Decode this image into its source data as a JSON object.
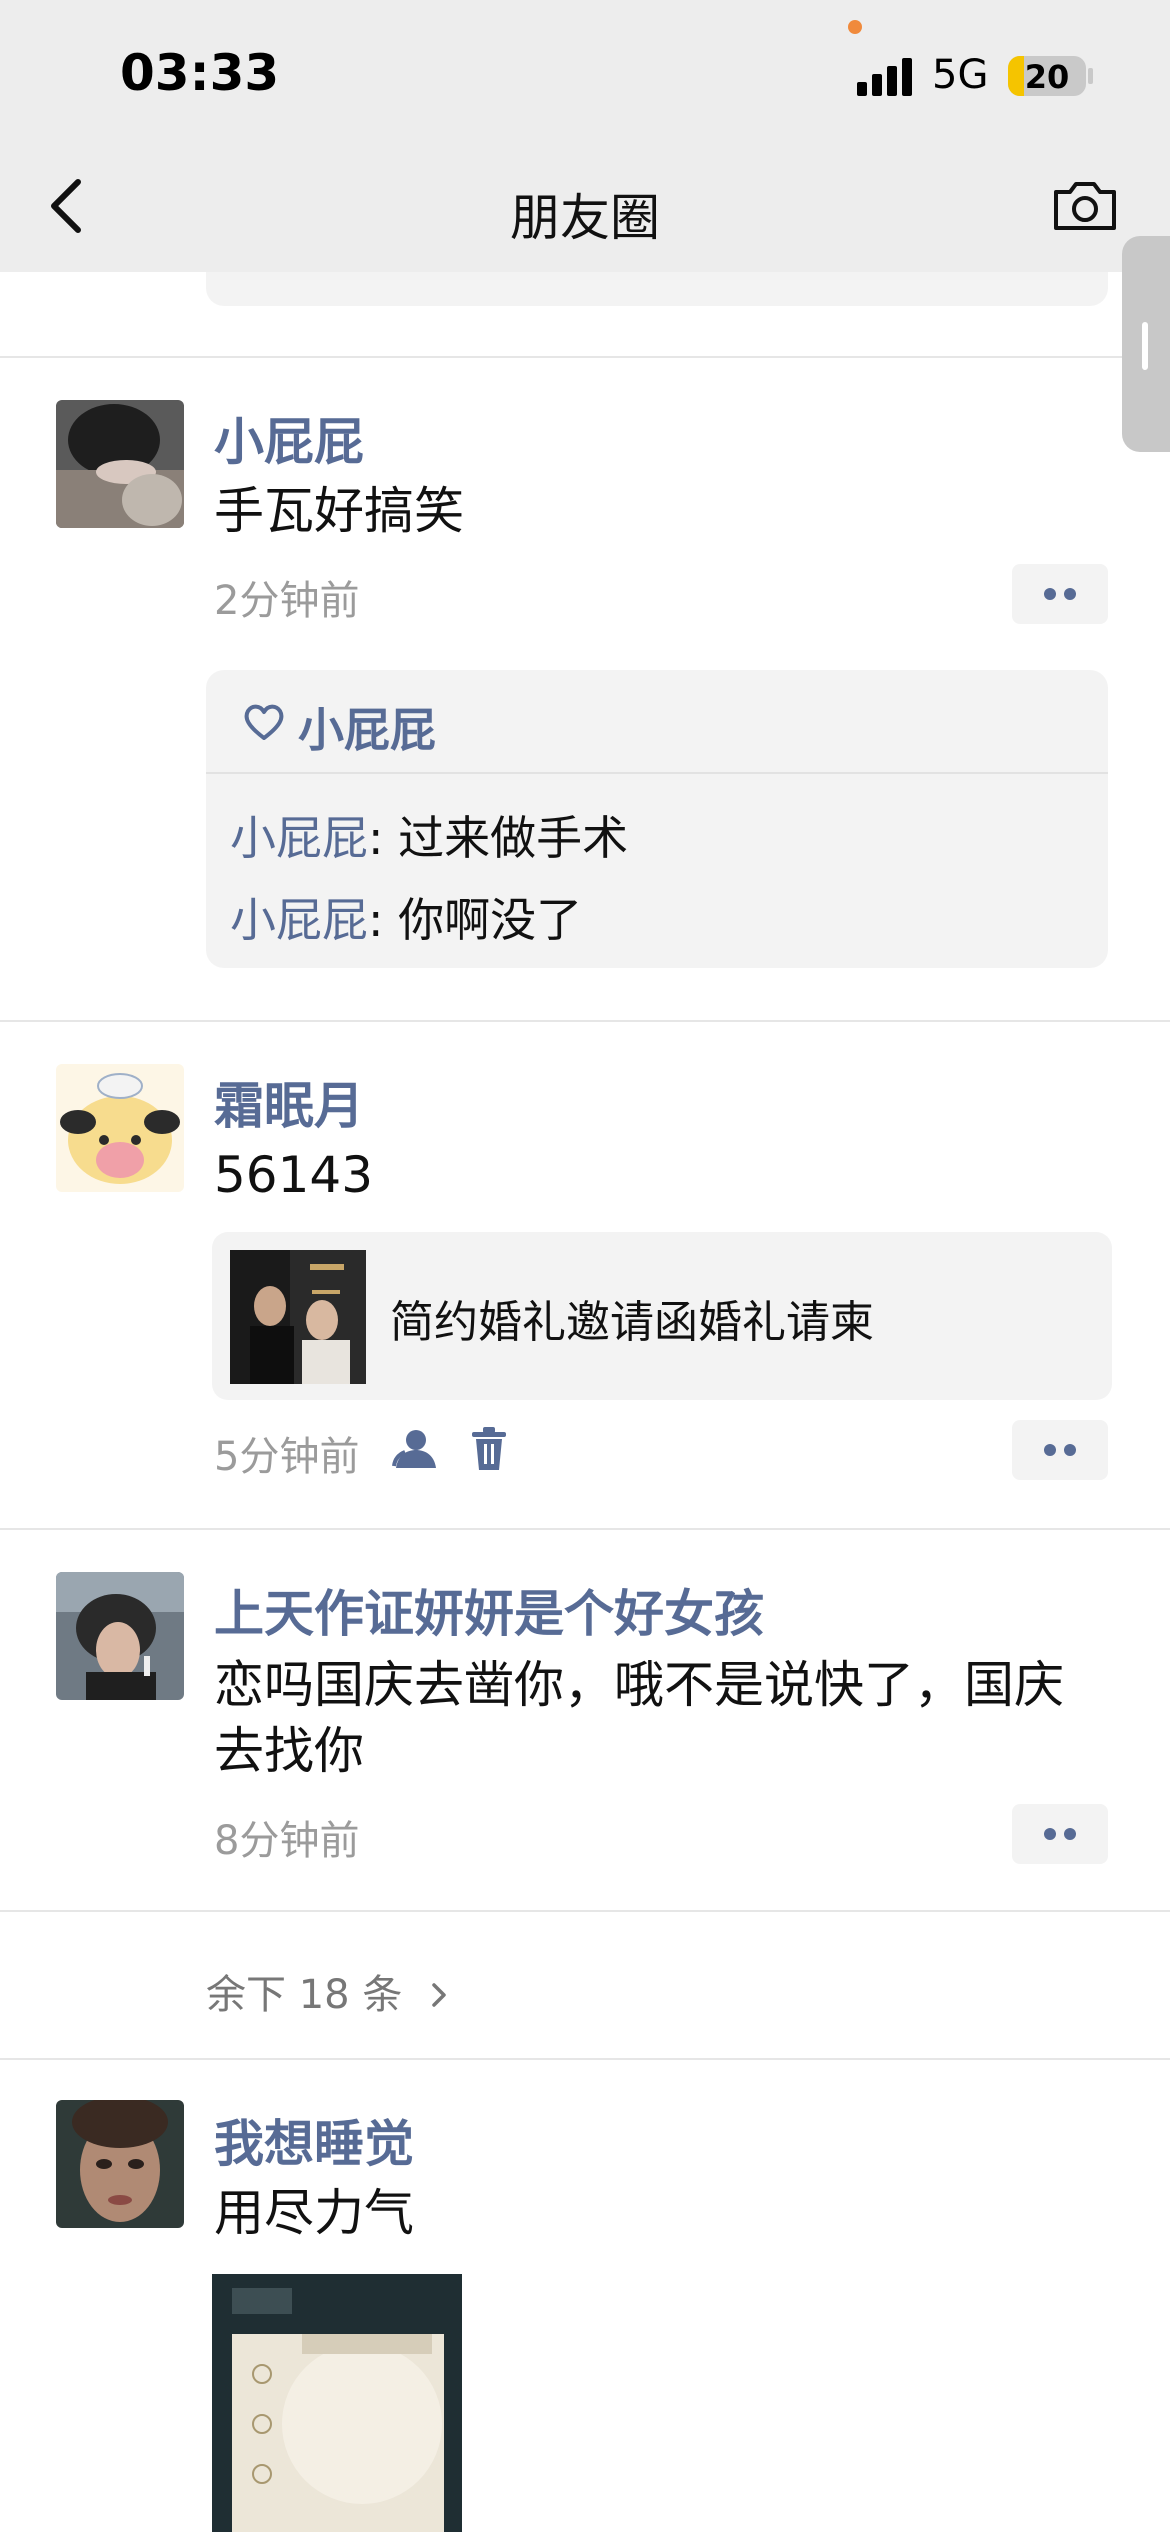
{
  "status": {
    "time": "03:33",
    "network": "5G",
    "battery": "20"
  },
  "nav": {
    "title": "朋友圈"
  },
  "posts": [
    {
      "name": "小屁屁",
      "text": "手瓦好搞笑",
      "time": "2分钟前",
      "likes": "小屁屁",
      "comments": [
        {
          "name": "小屁屁",
          "text": ": 过来做手术"
        },
        {
          "name": "小屁屁",
          "text": ": 你啊没了"
        }
      ]
    },
    {
      "name": "霜眠月",
      "text": "56143",
      "link_title": "简约婚礼邀请函婚礼请柬",
      "time": "5分钟前"
    },
    {
      "name": "上天作证妍妍是个好女孩",
      "text": "恋吗国庆去凿你，哦不是说快了，国庆去找你",
      "time": "8分钟前"
    },
    {
      "name": "我想睡觉",
      "text": "用尽力气"
    }
  ],
  "more_link": "余下 18 条"
}
